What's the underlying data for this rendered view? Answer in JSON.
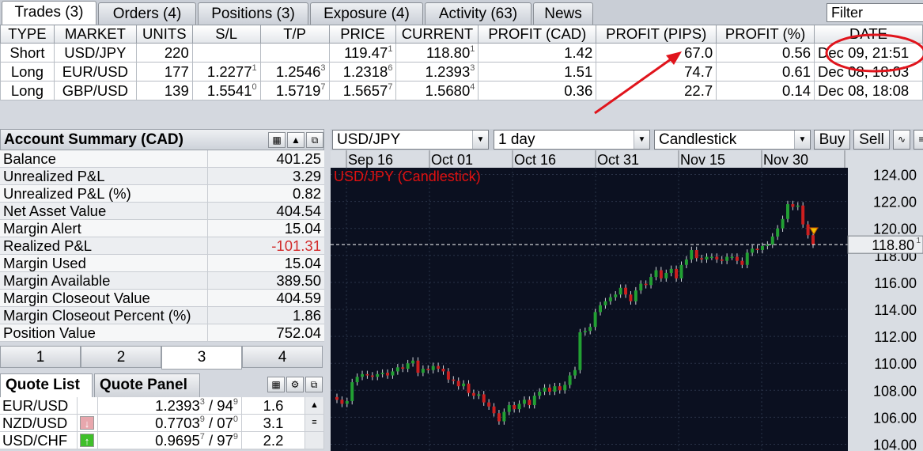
{
  "tabs": [
    {
      "label": "Trades (3)",
      "active": true
    },
    {
      "label": "Orders (4)",
      "active": false
    },
    {
      "label": "Positions (3)",
      "active": false
    },
    {
      "label": "Exposure (4)",
      "active": false
    },
    {
      "label": "Activity (63)",
      "active": false
    },
    {
      "label": "News",
      "active": false
    }
  ],
  "filter": {
    "value": "Filter"
  },
  "trades": {
    "headers": [
      "TYPE",
      "MARKET",
      "UNITS",
      "S/L",
      "T/P",
      "PRICE",
      "CURRENT",
      "PROFIT (CAD)",
      "PROFIT (PIPS)",
      "PROFIT (%)",
      "DATE"
    ],
    "rows": [
      {
        "type": "Short",
        "market": "USD/JPY",
        "units": "220",
        "sl": "",
        "sl_sup": "",
        "tp": "",
        "tp_sup": "",
        "price": "119.47",
        "price_sup": "1",
        "current": "118.80",
        "current_sup": "1",
        "profit_cad": "1.42",
        "profit_pips": "67.0",
        "profit_pct": "0.56",
        "date": "Dec 09, 21:51"
      },
      {
        "type": "Long",
        "market": "EUR/USD",
        "units": "177",
        "sl": "1.2277",
        "sl_sup": "1",
        "tp": "1.2546",
        "tp_sup": "3",
        "price": "1.2318",
        "price_sup": "6",
        "current": "1.2393",
        "current_sup": "3",
        "profit_cad": "1.51",
        "profit_pips": "74.7",
        "profit_pct": "0.61",
        "date": "Dec 08, 18:03"
      },
      {
        "type": "Long",
        "market": "GBP/USD",
        "units": "139",
        "sl": "1.5541",
        "sl_sup": "0",
        "tp": "1.5719",
        "tp_sup": "7",
        "price": "1.5657",
        "price_sup": "7",
        "current": "1.5680",
        "current_sup": "4",
        "profit_cad": "0.36",
        "profit_pips": "22.7",
        "profit_pct": "0.14",
        "date": "Dec 08, 18:08"
      }
    ]
  },
  "account": {
    "title": "Account Summary (CAD)",
    "rows": [
      {
        "label": "Balance",
        "value": "401.25"
      },
      {
        "label": "Unrealized P&L",
        "value": "3.29"
      },
      {
        "label": "Unrealized P&L (%)",
        "value": "0.82"
      },
      {
        "label": "Net Asset Value",
        "value": "404.54"
      },
      {
        "label": "Margin Alert",
        "value": "15.04"
      },
      {
        "label": "Realized P&L",
        "value": "-101.31",
        "negative": true
      },
      {
        "label": "Margin Used",
        "value": "15.04"
      },
      {
        "label": "Margin Available",
        "value": "389.50"
      },
      {
        "label": "Margin Closeout Value",
        "value": "404.59"
      },
      {
        "label": "Margin Closeout Percent (%)",
        "value": "1.86"
      },
      {
        "label": "Position Value",
        "value": "752.04"
      }
    ]
  },
  "num_tabs": [
    {
      "label": "1",
      "active": false
    },
    {
      "label": "2",
      "active": false
    },
    {
      "label": "3",
      "active": true
    },
    {
      "label": "4",
      "active": false
    }
  ],
  "quote_tabs": [
    {
      "label": "Quote List",
      "active": true
    },
    {
      "label": "Quote Panel",
      "active": false
    }
  ],
  "quotes": [
    {
      "symbol": "EUR/USD",
      "arrow": "",
      "bid": "1.2393",
      "bid_sup": "3",
      "ask": "94",
      "ask_sup": "9",
      "spread": "1.6"
    },
    {
      "symbol": "NZD/USD",
      "arrow": "down",
      "bid": "0.7703",
      "bid_sup": "9",
      "ask": "07",
      "ask_sup": "0",
      "spread": "3.1"
    },
    {
      "symbol": "USD/CHF",
      "arrow": "up",
      "bid": "0.9695",
      "bid_sup": "7",
      "ask": "97",
      "ask_sup": "9",
      "spread": "2.2"
    }
  ],
  "chart_toolbar": {
    "instrument": "USD/JPY",
    "timeframe": "1 day",
    "chart_type": "Candlestick",
    "buy_label": "Buy",
    "sell_label": "Sell"
  },
  "chart_data": {
    "type": "candlestick",
    "title": "USD/JPY (Candlestick)",
    "x_ticks": [
      "Sep 16",
      "Oct 01",
      "Oct 16",
      "Oct 31",
      "Nov 15",
      "Nov 30"
    ],
    "y_ticks": [
      "104.00",
      "106.00",
      "108.00",
      "110.00",
      "112.00",
      "114.00",
      "116.00",
      "118.00",
      "120.00",
      "122.00",
      "124.00"
    ],
    "ylim": [
      103.5,
      124.5
    ],
    "current_price": "118.80",
    "current_price_sup": "1",
    "close_series": [
      107.3,
      107.0,
      107.2,
      108.6,
      109.0,
      109.2,
      109.1,
      109.0,
      109.2,
      109.3,
      109.1,
      109.4,
      109.7,
      109.6,
      110.0,
      110.2,
      109.3,
      109.6,
      109.5,
      109.8,
      109.6,
      109.4,
      108.8,
      108.7,
      108.3,
      108.5,
      107.8,
      107.6,
      107.7,
      107.1,
      106.8,
      106.3,
      105.7,
      106.4,
      106.9,
      106.6,
      107.0,
      107.3,
      106.9,
      107.6,
      107.9,
      108.2,
      107.9,
      108.3,
      108.0,
      108.4,
      109.1,
      109.5,
      112.3,
      112.4,
      112.7,
      113.8,
      114.3,
      114.6,
      114.9,
      115.1,
      115.6,
      115.1,
      114.6,
      115.4,
      115.9,
      115.8,
      116.4,
      116.9,
      116.3,
      116.7,
      117.0,
      116.3,
      117.3,
      117.7,
      118.4,
      117.8,
      117.7,
      117.9,
      117.9,
      117.7,
      117.6,
      117.9,
      117.9,
      117.6,
      117.3,
      118.2,
      118.5,
      118.4,
      118.7,
      118.8,
      119.4,
      120.0,
      120.7,
      121.8,
      121.6,
      121.7,
      120.3,
      119.5,
      118.8
    ],
    "colors": {
      "up": "#22a033",
      "down": "#cc1f1f",
      "background": "#0b1020",
      "grid": "#2a3348",
      "title": "#e01010"
    }
  },
  "annotation": {
    "arrow_color": "#e0141c",
    "circle_color": "#e0141c"
  }
}
